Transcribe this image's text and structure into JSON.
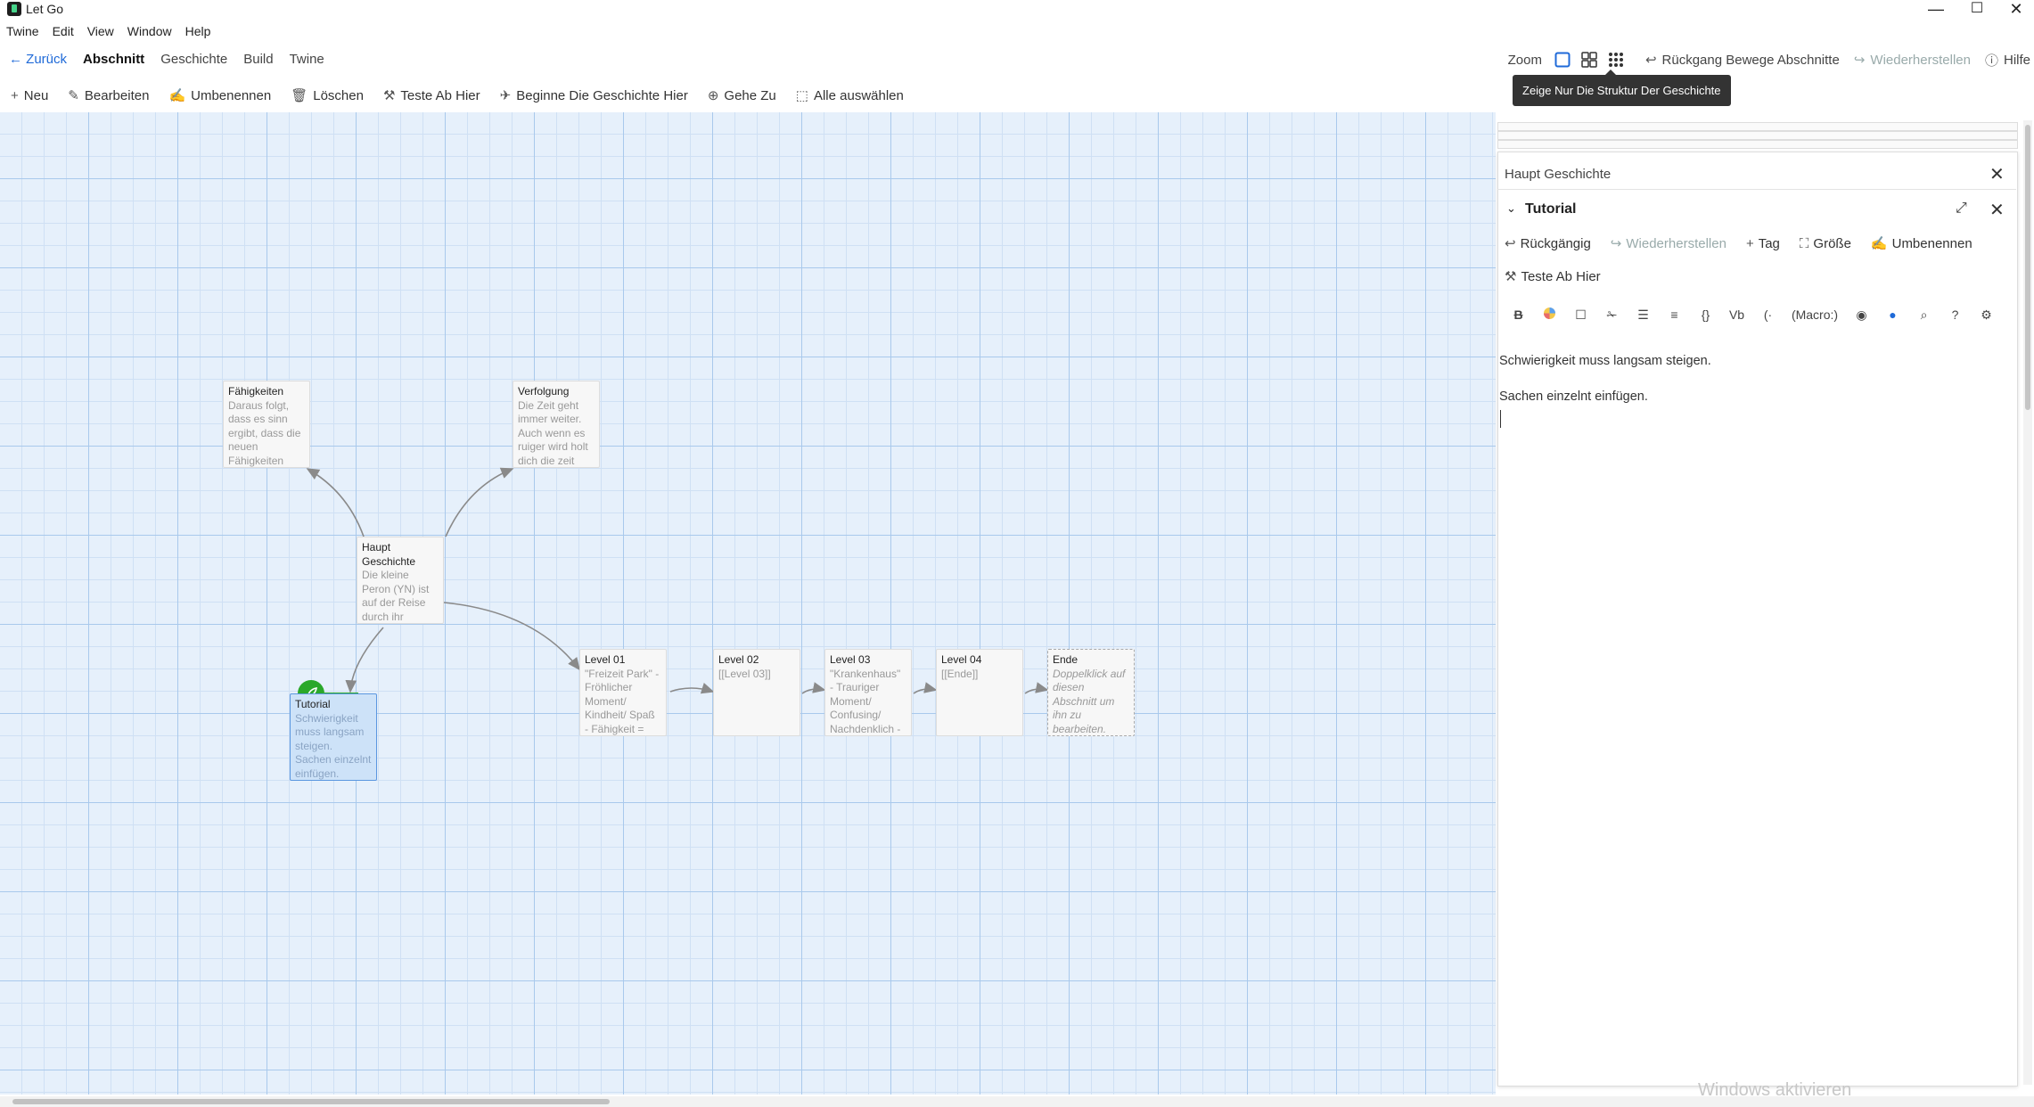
{
  "window": {
    "title": "Let Go",
    "minimize": "—",
    "maximize": "☐",
    "close": "✕"
  },
  "menubar": [
    "Twine",
    "Edit",
    "View",
    "Window",
    "Help"
  ],
  "routebar": {
    "back": "Zurück",
    "tabs": [
      "Abschnitt",
      "Geschichte",
      "Build",
      "Twine"
    ],
    "active_tab": "Abschnitt"
  },
  "right_tools": {
    "zoom_label": "Zoom",
    "undo": "Rückgang Bewege Abschnitte",
    "redo": "Wiederherstellen",
    "help": "Hilfe"
  },
  "tooltip": "Zeige Nur Die Struktur Der Geschichte",
  "actionbar": {
    "new": "Neu",
    "edit": "Bearbeiten",
    "rename": "Umbenennen",
    "delete": "Löschen",
    "test_from_here": "Teste Ab Hier",
    "start_story_here": "Beginne Die Geschichte Hier",
    "go_to": "Gehe Zu",
    "select_all": "Alle auswählen"
  },
  "passages": {
    "faehigkeiten": {
      "title": "Fähigkeiten",
      "excerpt": "Daraus folgt, dass es sinn ergibt, dass die neuen Fähigkeiten"
    },
    "verfolgung": {
      "title": "Verfolgung",
      "excerpt": "Die Zeit geht immer weiter. Auch wenn es ruiger wird holt dich die zeit"
    },
    "haupt": {
      "title": "Haupt Geschichte",
      "excerpt": "Die kleine Peron (YN) ist auf der Reise durch ihr Leben. Ich laufe"
    },
    "tutorial": {
      "title": "Tutorial",
      "excerpt": "Schwierigkeit muss langsam steigen. Sachen einzelnt einfügen."
    },
    "level01": {
      "title": "Level 01",
      "excerpt": "\"Freizeit Park\" - Fröhlicher Moment/ Kindheit/ Spaß - Fähigkeit ="
    },
    "level02": {
      "title": "Level 02",
      "excerpt": "[[Level 03]]"
    },
    "level03": {
      "title": "Level 03",
      "excerpt": "\"Krankenhaus\" - Trauriger Moment/ Confusing/ Nachdenklich -"
    },
    "level04": {
      "title": "Level 04",
      "excerpt": "[[Ende]]"
    },
    "ende": {
      "title": "Ende",
      "excerpt": "Doppelklick auf diesen Abschnitt um ihn zu bearbeiten."
    }
  },
  "dialog": {
    "story_title": "Haupt Geschichte",
    "passage_title": "Tutorial",
    "toolbar": {
      "undo": "Rückgängig",
      "redo": "Wiederherstellen",
      "tag": "Tag",
      "size": "Größe",
      "rename": "Umbenennen",
      "test_from_here": "Teste Ab Hier"
    },
    "format_macro": "(Macro:)",
    "text_line1": "Schwierigkeit muss langsam steigen.",
    "text_line2": "Sachen einzelnt einfügen."
  },
  "watermark": "Windows aktivieren",
  "colors": {
    "accent": "#1f6ad8",
    "start": "#2aa82a",
    "grid": "#e6f0fb",
    "selected": "#cde2f8"
  }
}
